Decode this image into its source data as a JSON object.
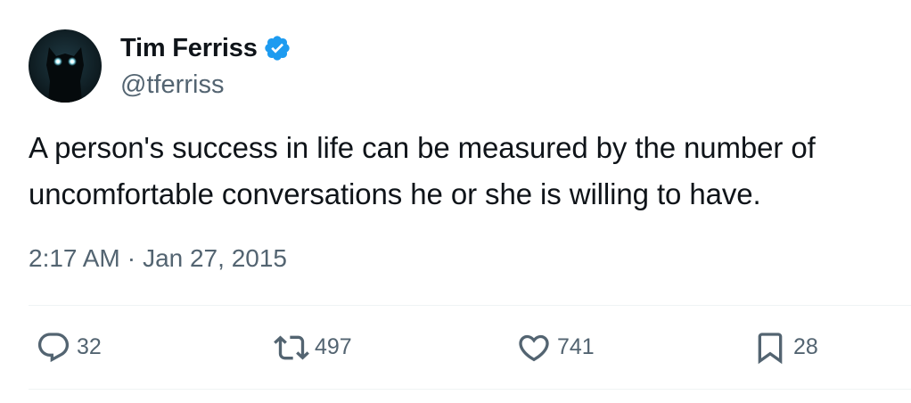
{
  "author": {
    "display_name": "Tim Ferriss",
    "handle": "@tferriss",
    "verified_icon": "verified-badge-icon",
    "verified_color": "#1d9bf0"
  },
  "tweet": {
    "text": "A person's success in life can be measured by the number of uncomfortable conversations he or she is willing to have.",
    "time": "2:17 AM",
    "separator": "·",
    "date": "Jan 27, 2015"
  },
  "actions": {
    "replies": "32",
    "retweets": "497",
    "likes": "741",
    "bookmarks": "28"
  },
  "colors": {
    "text_primary": "#0f1419",
    "text_secondary": "#536471",
    "divider": "#eff3f4"
  }
}
